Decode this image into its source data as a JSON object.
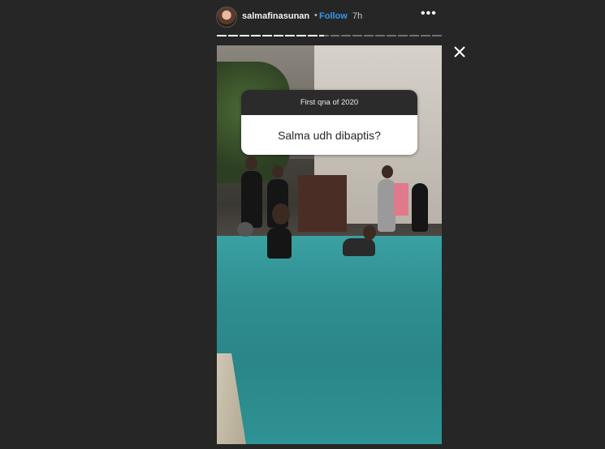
{
  "header": {
    "username": "salmafinasunan",
    "separator": "•",
    "follow_label": "Follow",
    "time": "7h",
    "more_label": "•••"
  },
  "progress": {
    "segments": 20,
    "completed": 9
  },
  "question": {
    "header": "First qna of 2020",
    "text": "Salma udh dibaptis?"
  },
  "icons": {
    "close": "close-icon",
    "more": "more-options-icon"
  },
  "colors": {
    "background": "#262626",
    "follow": "#3897f0",
    "pool": "#2f8e90"
  }
}
